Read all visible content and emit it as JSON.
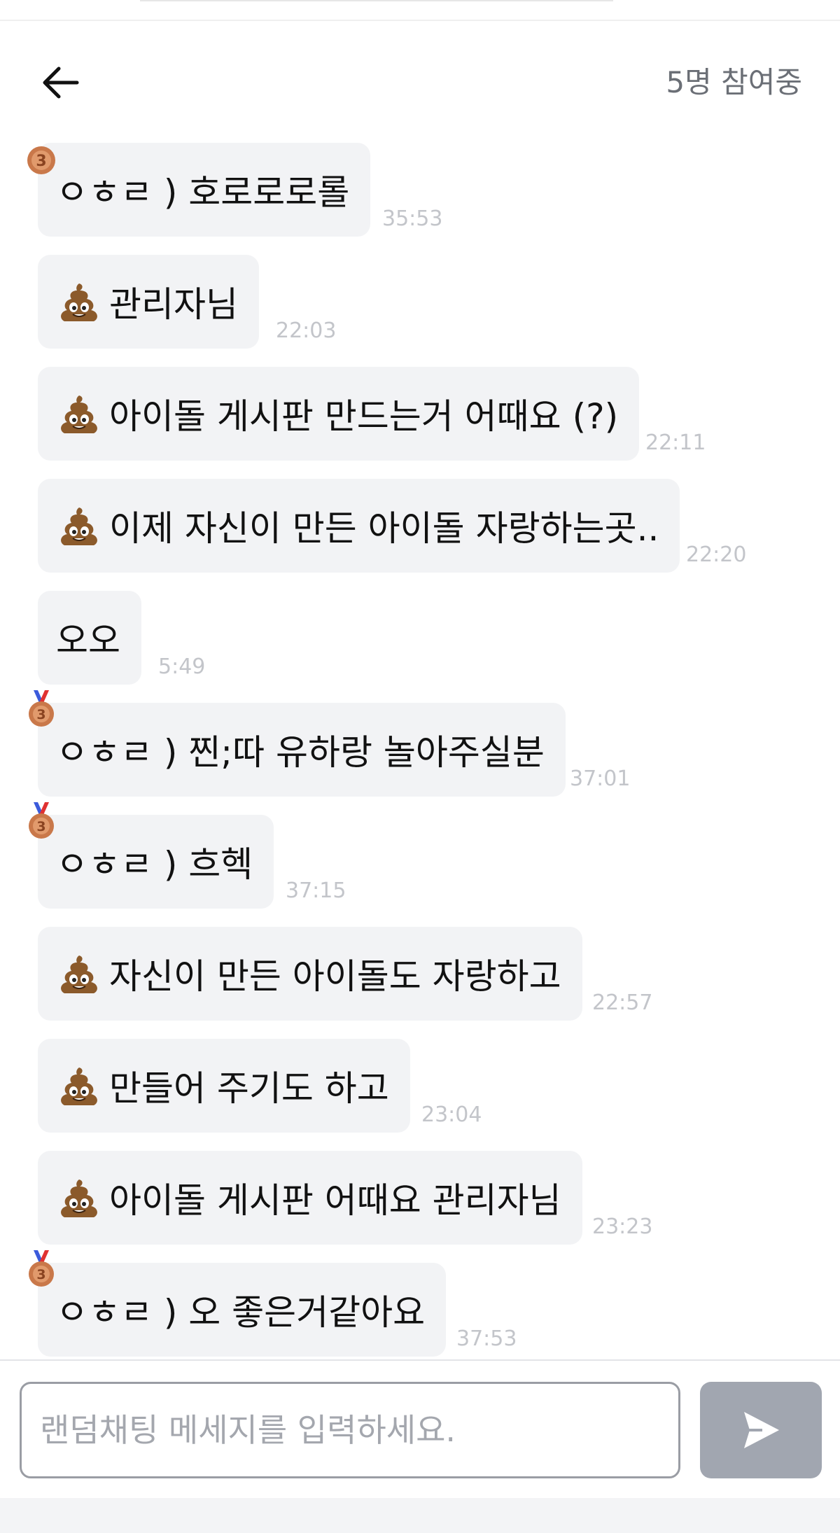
{
  "header": {
    "participants": "5명 참여중"
  },
  "messages": [
    {
      "text": "ㅇㅎㄹ ) 호로로로롤",
      "time": "35:53",
      "badge": "medal-3",
      "emoji": null
    },
    {
      "text": "관리자님",
      "time": "22:03",
      "badge": null,
      "emoji": "poop-emoji"
    },
    {
      "text": "아이돌 게시판 만드는거 어때요 (?)",
      "time": "22:11",
      "badge": null,
      "emoji": "poop-emoji"
    },
    {
      "text": "이제 자신이 만든 아이돌 자랑하는곳..",
      "time": "22:20",
      "badge": null,
      "emoji": "poop-emoji"
    },
    {
      "text": "오오",
      "time": "5:49",
      "badge": null,
      "emoji": null
    },
    {
      "text": "ㅇㅎㄹ ) 찐;따 유하랑 놀아주실분",
      "time": "37:01",
      "badge": "medal-3",
      "emoji": null
    },
    {
      "text": "ㅇㅎㄹ ) 흐헥",
      "time": "37:15",
      "badge": "medal-3",
      "emoji": null
    },
    {
      "text": "자신이 만든 아이돌도 자랑하고",
      "time": "22:57",
      "badge": null,
      "emoji": "poop-emoji"
    },
    {
      "text": "만들어 주기도 하고",
      "time": "23:04",
      "badge": null,
      "emoji": "poop-emoji"
    },
    {
      "text": "아이돌 게시판 어때요 관리자님",
      "time": "23:23",
      "badge": null,
      "emoji": "poop-emoji"
    },
    {
      "text": "ㅇㅎㄹ ) 오 좋은거같아요",
      "time": "37:53",
      "badge": "medal-3",
      "emoji": null
    }
  ],
  "input": {
    "placeholder": "랜덤채팅 메세지를 입력하세요.",
    "value": ""
  },
  "icons": {
    "back": "arrow-left-icon",
    "send": "send-icon",
    "medal": "bronze-medal-3-icon",
    "poop": "poop-emoji"
  },
  "colors": {
    "bubble": "#f2f3f5",
    "timestamp": "#c3c5ca",
    "send_button": "#a1a6b0",
    "participants_text": "#6b6f76"
  }
}
